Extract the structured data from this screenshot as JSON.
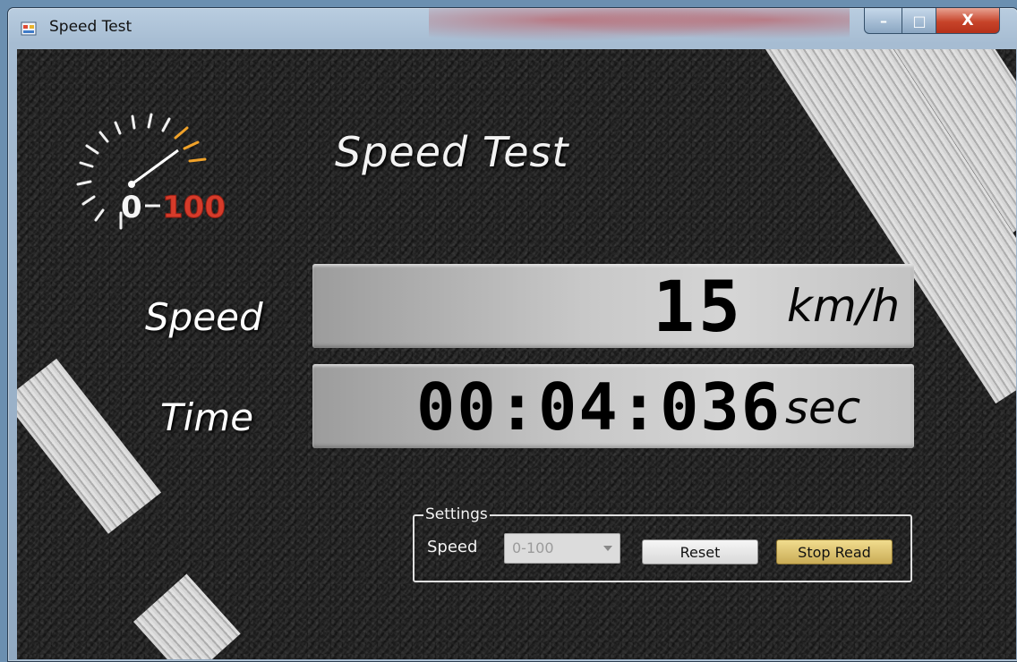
{
  "window": {
    "title": "Speed Test",
    "buttons": {
      "minimize": "–",
      "maximize": "□",
      "close": "X"
    }
  },
  "app": {
    "heading": "Speed Test",
    "logo": {
      "left": "0",
      "right": "100",
      "accent_color": "#d63b2a"
    },
    "speed": {
      "label": "Speed",
      "value": "15",
      "unit": "km/h"
    },
    "time": {
      "label": "Time",
      "value": "00:04:036",
      "unit": "sec"
    }
  },
  "settings": {
    "legend": "Settings",
    "speed_label": "Speed",
    "speed_select": "0-100",
    "reset_label": "Reset",
    "stop_label": "Stop Read"
  },
  "colors": {
    "asphalt": "#202020",
    "panel": "#c8c8c8",
    "stop_button": "#d9bd68",
    "close_button": "#c7442a"
  }
}
